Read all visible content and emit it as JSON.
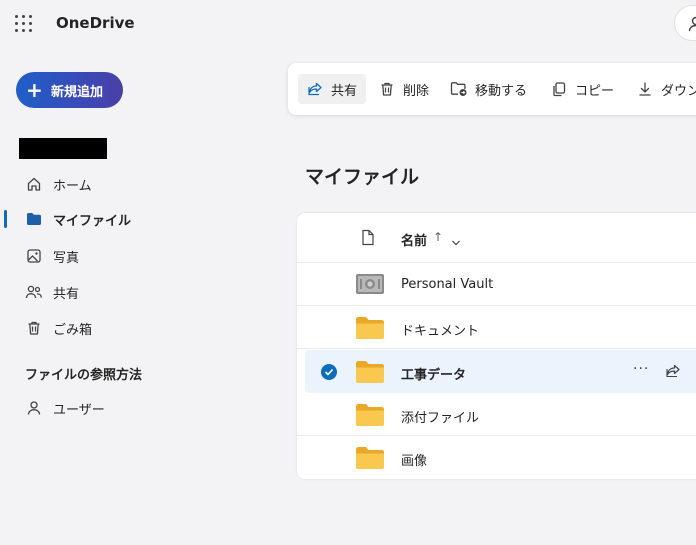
{
  "header": {
    "brand": "OneDrive"
  },
  "new_button": {
    "label": "新規追加"
  },
  "sidebar": {
    "items": [
      {
        "label": "ホーム",
        "icon": "home-icon"
      },
      {
        "label": "マイファイル",
        "icon": "folder-icon",
        "active": true
      },
      {
        "label": "写真",
        "icon": "image-icon"
      },
      {
        "label": "共有",
        "icon": "people-icon"
      },
      {
        "label": "ごみ箱",
        "icon": "trash-icon"
      }
    ],
    "browse_section": {
      "title": "ファイルの参照方法",
      "items": [
        {
          "label": "ユーザー",
          "icon": "person-icon"
        }
      ]
    }
  },
  "toolbar": {
    "share": "共有",
    "delete": "削除",
    "move": "移動する",
    "copy": "コピー",
    "download": "ダウン"
  },
  "page": {
    "title": "マイファイル"
  },
  "file_list": {
    "columns": {
      "name": "名前",
      "sort_indicator": "↑"
    },
    "rows": [
      {
        "name": "Personal Vault",
        "type": "vault",
        "selected": false
      },
      {
        "name": "ドキュメント",
        "type": "folder",
        "selected": false
      },
      {
        "name": "工事データ",
        "type": "folder",
        "selected": true
      },
      {
        "name": "添付ファイル",
        "type": "folder",
        "selected": false
      },
      {
        "name": "画像",
        "type": "folder",
        "selected": false
      }
    ],
    "more_label": "···"
  },
  "colors": {
    "accent": "#0f6cbd",
    "folder": "#f5c342",
    "selected_row": "#ebf3fc"
  }
}
